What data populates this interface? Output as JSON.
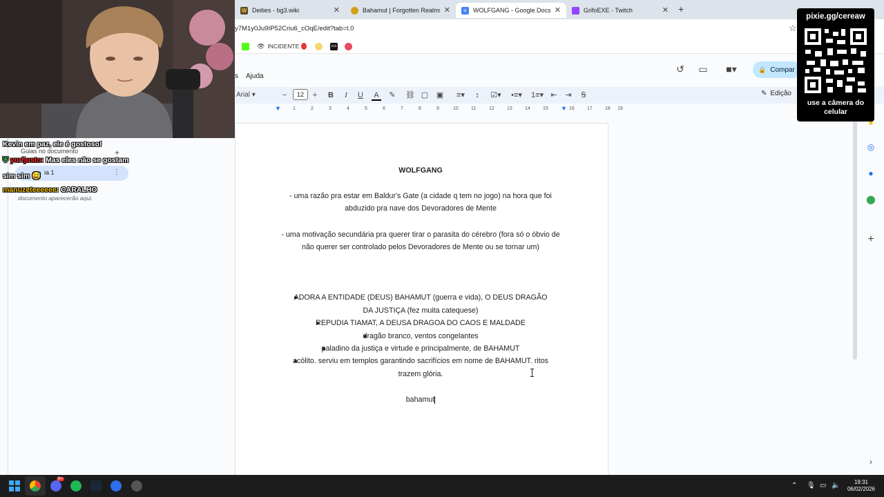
{
  "browser": {
    "tabs": [
      {
        "title": "Deities - bg3.wiki",
        "active": false
      },
      {
        "title": "Bahamut | Forgotten Realms W",
        "active": false
      },
      {
        "title": "WOLFGANG - Google Docs",
        "active": true
      },
      {
        "title": "GrifoEXE - Twitch",
        "active": false
      }
    ],
    "url": "y7M1y0Ju9IP52Criu6_cOqE/edit?tab=t.0",
    "bookmarks": [
      {
        "label": "INCIDENTE"
      }
    ]
  },
  "docs": {
    "menu": [
      "s",
      "Ajuda"
    ],
    "share_label": "Compar",
    "edit_mode_label": "Edição",
    "font_name": "Arial",
    "font_size": "12",
    "ruler_marks": [
      "1",
      "2",
      "3",
      "4",
      "5",
      "6",
      "7",
      "8",
      "9",
      "10",
      "11",
      "12",
      "13",
      "14",
      "15",
      "16",
      "17",
      "18",
      "19"
    ]
  },
  "left_pane": {
    "title": "Guias no documento",
    "tab_item": "ia 1",
    "hint": "documento aparecerão aqui."
  },
  "document": {
    "title": "WOLFGANG",
    "para1_line1": "- uma razão pra estar em Baldur's Gate (a cidade q tem no jogo) na hora que foi",
    "para1_line2": "abduzido pra nave dos Devoradores de Mente",
    "para2_line1": "- uma motivação secundária pra querer tirar o parasita do cérebro (fora só o óbvio de",
    "para2_line2": "não querer ser controlado pelos Devoradores de Mente ou se tornar um)",
    "bullets": [
      "ADORA A ENTIDADE (DEUS) BAHAMUT (guerra e vida), O DEUS DRAGÃO",
      "DA JUSTIÇA (fez muita catequese)",
      "REPUDIA TIAMAT, A DEUSA DRAGOA DO CAOS E MALDADE",
      "dragão branco, ventos congelantes",
      "paladino da justiça e virtude e principalmente, de BAHAMUT",
      "acólito. serviu em templos garantindo sacrifícios em nome de BAHAMUT. ritos",
      "trazem glória."
    ],
    "last_line": "bahamut"
  },
  "chat": [
    {
      "user": "",
      "text": "Kevin em paz, ele é gostoso!"
    },
    {
      "user": "yorfjusto:",
      "text": "Mas eles não se gostam"
    },
    {
      "user": "",
      "text": "sim sim"
    },
    {
      "user": "manuzeteeeeee:",
      "text": "CARALHO"
    }
  ],
  "qr_overlay": {
    "top": "pixie.gg/cereaw",
    "bottom": "use a câmera do celular"
  },
  "taskbar": {
    "time": "19:31",
    "date": "06/02/2026",
    "badge": "9+"
  },
  "colors": {
    "docs_blue": "#1a73e8",
    "share_bg": "#c2e7ff",
    "toolbar_bg": "#edf2fa",
    "tabbar_bg": "#dde3ea"
  }
}
